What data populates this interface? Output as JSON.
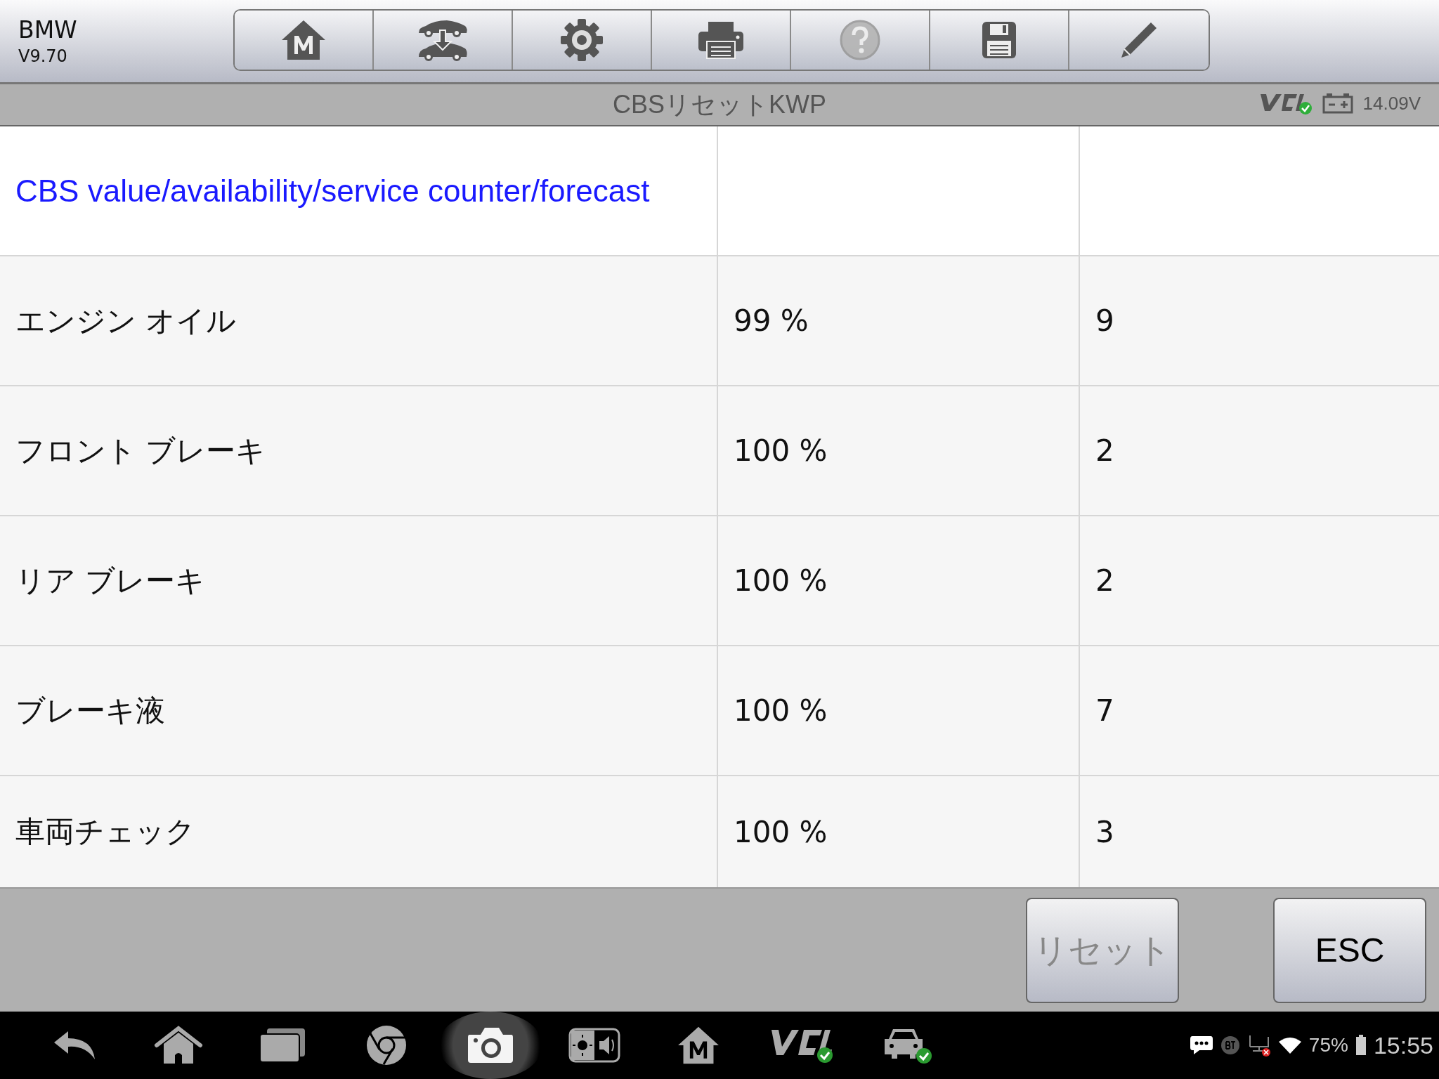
{
  "app": {
    "make": "BMW",
    "version": "V9.70"
  },
  "toolbar": [
    {
      "kind": "home",
      "disabled": false
    },
    {
      "kind": "vehicle-swap",
      "disabled": false
    },
    {
      "kind": "settings",
      "disabled": false
    },
    {
      "kind": "print",
      "disabled": false
    },
    {
      "kind": "help",
      "disabled": true
    },
    {
      "kind": "save",
      "disabled": false
    },
    {
      "kind": "edit",
      "disabled": false
    }
  ],
  "title_bar": {
    "title": "CBSリセットKWP",
    "vci_connected": true,
    "voltage": "14.09V"
  },
  "table": {
    "heading": "CBS value/availability/service counter/forecast",
    "rows": [
      {
        "item": "エンジン オイル",
        "value": "99 %",
        "count": "9"
      },
      {
        "item": "フロント ブレーキ",
        "value": "100 %",
        "count": "2"
      },
      {
        "item": "リア ブレーキ",
        "value": "100 %",
        "count": "2"
      },
      {
        "item": "ブレーキ液",
        "value": "100 %",
        "count": "7"
      },
      {
        "item": "車両チェック",
        "value": "100 %",
        "count": "3"
      }
    ]
  },
  "buttons": [
    {
      "label": "リセット",
      "disabled": true
    },
    {
      "label": "ESC",
      "disabled": false
    }
  ],
  "nav_bar": {
    "items": [
      {
        "kind": "back",
        "selected": false
      },
      {
        "kind": "home",
        "selected": false
      },
      {
        "kind": "recent",
        "selected": false
      },
      {
        "kind": "browser",
        "selected": false
      },
      {
        "kind": "camera",
        "selected": true
      },
      {
        "kind": "display",
        "selected": false
      },
      {
        "kind": "app-home",
        "selected": false
      },
      {
        "kind": "vci",
        "selected": false
      },
      {
        "kind": "car",
        "selected": false
      }
    ],
    "battery": "75%",
    "time": "15:55"
  }
}
